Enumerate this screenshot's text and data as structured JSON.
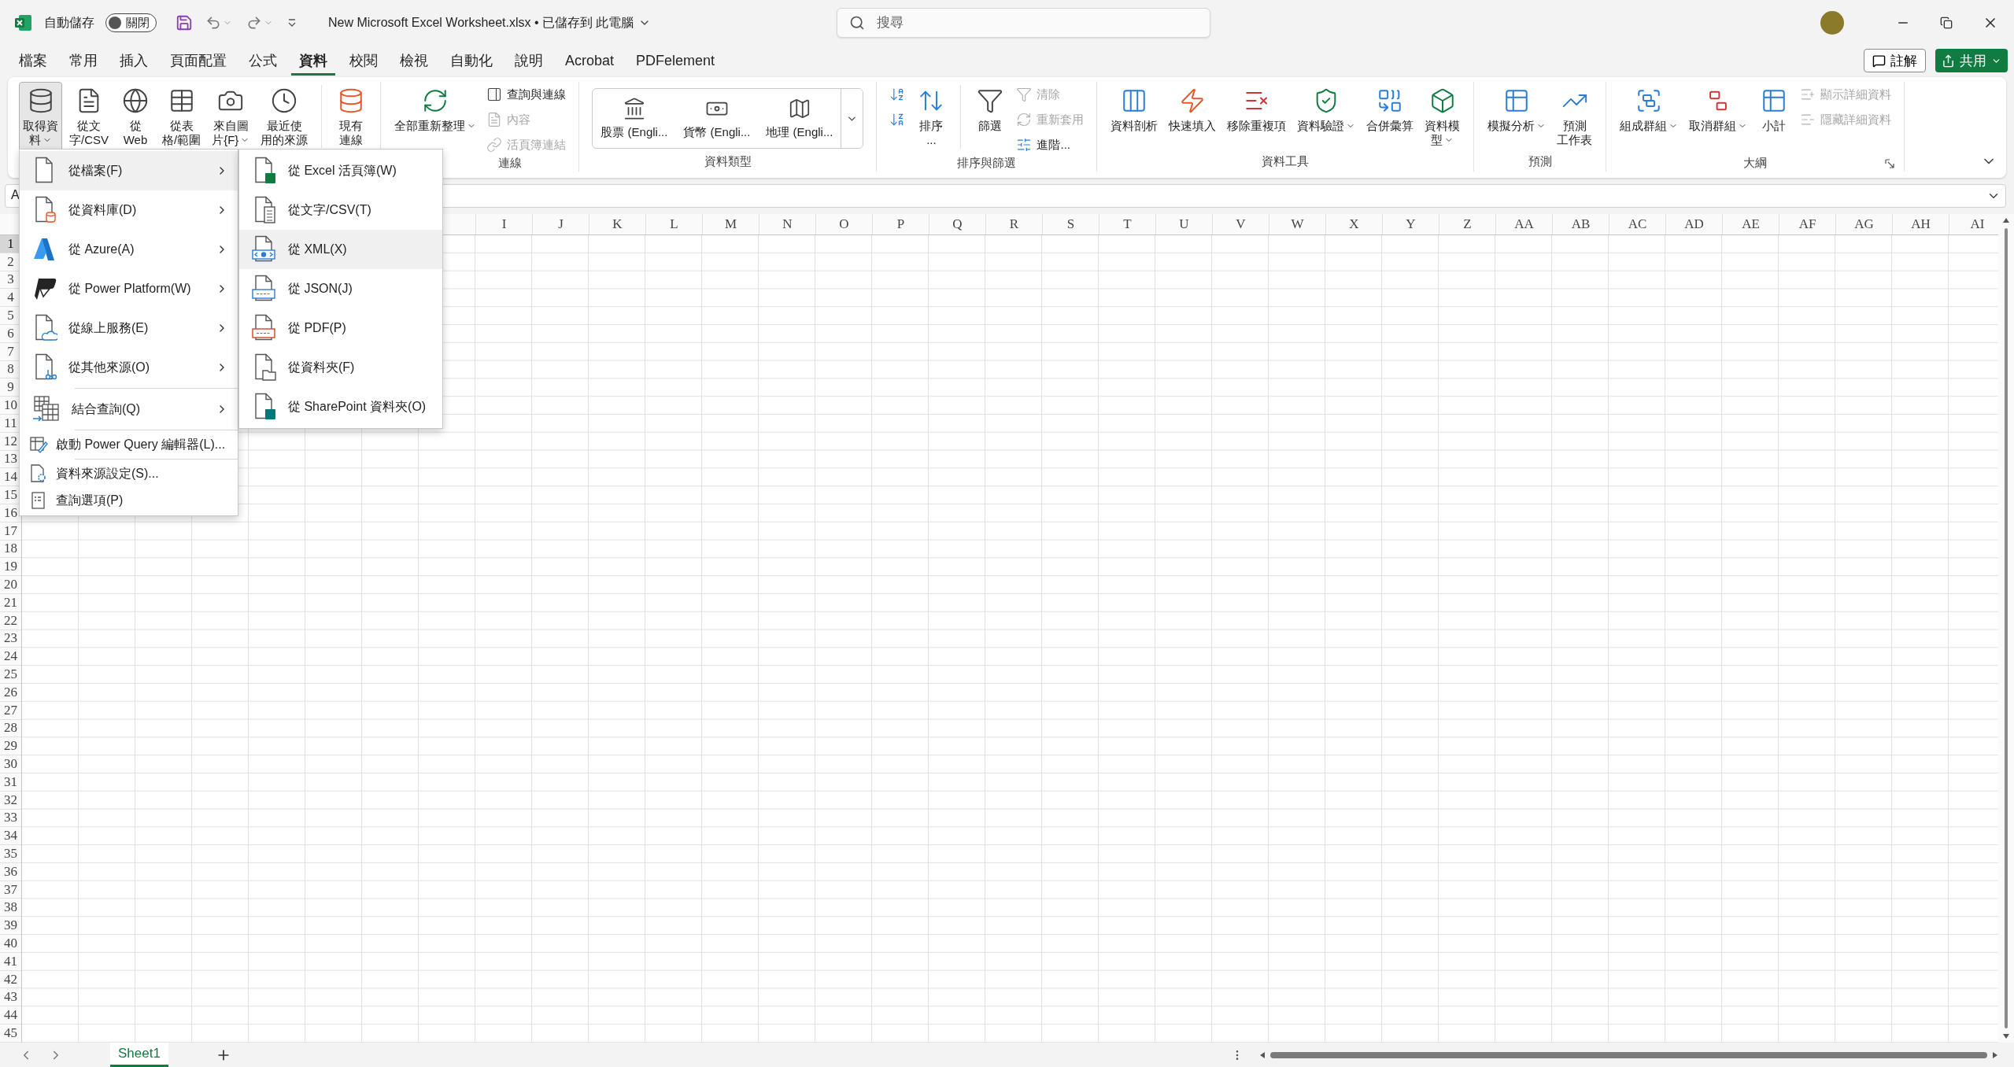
{
  "title_bar": {
    "autosave_label": "自動儲存",
    "autosave": {
      "on": false,
      "label": "關閉"
    },
    "document_title": "New Microsoft Excel Worksheet.xlsx • 已儲存到 此電腦",
    "search": {
      "placeholder": "搜尋"
    }
  },
  "tabs": [
    {
      "label": "檔案",
      "selected": false
    },
    {
      "label": "常用",
      "selected": false
    },
    {
      "label": "插入",
      "selected": false
    },
    {
      "label": "頁面配置",
      "selected": false
    },
    {
      "label": "公式",
      "selected": false
    },
    {
      "label": "資料",
      "selected": true
    },
    {
      "label": "校閱",
      "selected": false
    },
    {
      "label": "檢視",
      "selected": false
    },
    {
      "label": "自動化",
      "selected": false
    },
    {
      "label": "說明",
      "selected": false
    },
    {
      "label": "Acrobat",
      "selected": false
    },
    {
      "label": "PDFelement",
      "selected": false
    }
  ],
  "comments_button": "註解",
  "share_button": "共用",
  "ribbon": {
    "groups": [
      {
        "items": [
          {
            "kind": "large",
            "lines": [
              "取得資",
              "料"
            ],
            "dropdown": true,
            "pressed": true
          },
          {
            "kind": "large",
            "lines": [
              "從文",
              "字/CSV"
            ],
            "dropdown": false,
            "pressed": false
          },
          {
            "kind": "large",
            "lines": [
              "從",
              "Web"
            ],
            "dropdown": false,
            "pressed": false
          },
          {
            "kind": "large",
            "lines": [
              "從表",
              "格/範圍"
            ],
            "dropdown": false,
            "pressed": false
          },
          {
            "kind": "large",
            "lines": [
              "來自圖",
              "片{F}"
            ],
            "dropdown": true,
            "pressed": false
          },
          {
            "kind": "large",
            "lines": [
              "最近使",
              "用的來源"
            ],
            "dropdown": false,
            "pressed": false
          },
          {
            "kind": "separator"
          },
          {
            "kind": "large",
            "lines": [
              "現有",
              "連線"
            ],
            "dropdown": false,
            "pressed": false
          }
        ]
      },
      {
        "label": "連線",
        "items": [
          {
            "kind": "large",
            "lines": [
              "全部重新整理"
            ],
            "dropdown": true,
            "pressed": false
          },
          {
            "kind": "stack",
            "items": [
              {
                "label": "查詢與連線",
                "disabled": false
              },
              {
                "label": "內容",
                "disabled": true
              },
              {
                "label": "活頁簿連結",
                "disabled": true
              }
            ]
          }
        ]
      },
      {
        "label": "資料類型",
        "items": [
          {
            "kind": "gallery",
            "items": [
              {
                "label": "股票 (Engli..."
              },
              {
                "label": "貨幣 (Engli..."
              },
              {
                "label": "地理 (Engli..."
              }
            ]
          }
        ]
      },
      {
        "label": "排序與篩選",
        "items": [
          {
            "kind": "stack",
            "items": [
              {
                "disabled": false
              },
              {
                "disabled": false
              }
            ]
          },
          {
            "kind": "large",
            "lines": [
              "排序",
              "..."
            ],
            "dropdown": false,
            "pressed": false
          },
          {
            "kind": "separator"
          },
          {
            "kind": "large",
            "lines": [
              "篩選"
            ],
            "dropdown": false,
            "pressed": false
          },
          {
            "kind": "stack",
            "items": [
              {
                "label": "清除",
                "disabled": true
              },
              {
                "label": "重新套用",
                "disabled": true
              },
              {
                "label": "進階...",
                "disabled": false
              }
            ]
          }
        ]
      },
      {
        "label": "資料工具",
        "items": [
          {
            "kind": "large",
            "lines": [
              "資料剖析"
            ],
            "dropdown": false,
            "pressed": false
          },
          {
            "kind": "large",
            "lines": [
              "快速填入"
            ],
            "dropdown": false,
            "pressed": false
          },
          {
            "kind": "large",
            "lines": [
              "移除重複項"
            ],
            "dropdown": false,
            "pressed": false
          },
          {
            "kind": "large",
            "lines": [
              "資料驗證"
            ],
            "dropdown": true,
            "pressed": false
          },
          {
            "kind": "large",
            "lines": [
              "合併彙算"
            ],
            "dropdown": false,
            "pressed": false
          },
          {
            "kind": "large",
            "lines": [
              "資料模",
              "型"
            ],
            "dropdown": true,
            "pressed": false
          }
        ]
      },
      {
        "label": "預測",
        "items": [
          {
            "kind": "large",
            "lines": [
              "模擬分析"
            ],
            "dropdown": true,
            "pressed": false
          },
          {
            "kind": "large",
            "lines": [
              "預測",
              "工作表"
            ],
            "dropdown": false,
            "pressed": false
          }
        ]
      },
      {
        "label": "大綱",
        "items": [
          {
            "kind": "large",
            "lines": [
              "組成群組"
            ],
            "dropdown": true,
            "pressed": false
          },
          {
            "kind": "large",
            "lines": [
              "取消群組"
            ],
            "dropdown": true,
            "pressed": false
          },
          {
            "kind": "large",
            "lines": [
              "小計"
            ],
            "dropdown": false,
            "pressed": false
          },
          {
            "kind": "stack",
            "items": [
              {
                "label": "顯示詳細資料",
                "disabled": true
              },
              {
                "label": "隱藏詳細資料",
                "disabled": true
              }
            ]
          }
        ]
      }
    ]
  },
  "formula_bar": {
    "name_box": "A"
  },
  "columns": [
    "I",
    "J",
    "K",
    "L",
    "M",
    "N",
    "O",
    "P",
    "Q",
    "R",
    "S",
    "T",
    "U",
    "V",
    "W",
    "X",
    "Y",
    "Z",
    "AA",
    "AB",
    "AC",
    "AD",
    "AE",
    "AF",
    "AG",
    "AH",
    "AI"
  ],
  "rows": [
    {
      "label": "1",
      "selected": true
    },
    {
      "label": "2",
      "selected": false
    },
    {
      "label": "3",
      "selected": false
    },
    {
      "label": "4",
      "selected": false
    },
    {
      "label": "5",
      "selected": false
    },
    {
      "label": "6",
      "selected": false
    },
    {
      "label": "7",
      "selected": false
    },
    {
      "label": "8",
      "selected": false
    },
    {
      "label": "9",
      "selected": false
    },
    {
      "label": "10",
      "selected": false
    },
    {
      "label": "11",
      "selected": false
    },
    {
      "label": "12",
      "selected": false
    },
    {
      "label": "13",
      "selected": false
    },
    {
      "label": "14",
      "selected": false
    },
    {
      "label": "15",
      "selected": false
    },
    {
      "label": "16",
      "selected": false
    },
    {
      "label": "17",
      "selected": false
    },
    {
      "label": "18",
      "selected": false
    },
    {
      "label": "19",
      "selected": false
    },
    {
      "label": "20",
      "selected": false
    },
    {
      "label": "21",
      "selected": false
    },
    {
      "label": "22",
      "selected": false
    },
    {
      "label": "23",
      "selected": false
    },
    {
      "label": "24",
      "selected": false
    },
    {
      "label": "25",
      "selected": false
    },
    {
      "label": "26",
      "selected": false
    },
    {
      "label": "27",
      "selected": false
    },
    {
      "label": "28",
      "selected": false
    },
    {
      "label": "29",
      "selected": false
    },
    {
      "label": "30",
      "selected": false
    },
    {
      "label": "31",
      "selected": false
    },
    {
      "label": "32",
      "selected": false
    },
    {
      "label": "33",
      "selected": false
    },
    {
      "label": "34",
      "selected": false
    },
    {
      "label": "35",
      "selected": false
    },
    {
      "label": "36",
      "selected": false
    },
    {
      "label": "37",
      "selected": false
    },
    {
      "label": "38",
      "selected": false
    },
    {
      "label": "39",
      "selected": false
    },
    {
      "label": "40",
      "selected": false
    },
    {
      "label": "41",
      "selected": false
    },
    {
      "label": "42",
      "selected": false
    },
    {
      "label": "43",
      "selected": false
    },
    {
      "label": "44",
      "selected": false
    },
    {
      "label": "45",
      "selected": false
    }
  ],
  "sheets": [
    {
      "label": "Sheet1",
      "selected": true
    }
  ],
  "get_data_menu": {
    "items": [
      {
        "kind": "large",
        "label": "從檔案(F)",
        "submenu": true,
        "selected": true
      },
      {
        "kind": "large",
        "label": "從資料庫(D)",
        "submenu": true,
        "selected": false
      },
      {
        "kind": "large",
        "label": "從 Azure(A)",
        "submenu": true,
        "selected": false
      },
      {
        "kind": "large",
        "label": "從 Power Platform(W)",
        "submenu": true,
        "selected": false
      },
      {
        "kind": "large",
        "label": "從線上服務(E)",
        "submenu": true,
        "selected": false
      },
      {
        "kind": "large",
        "label": "從其他來源(O)",
        "submenu": true,
        "selected": false
      },
      {
        "kind": "separator"
      },
      {
        "kind": "large",
        "label": "結合查詢(Q)",
        "submenu": true,
        "selected": false
      },
      {
        "kind": "separator"
      },
      {
        "kind": "small",
        "label": "啟動 Power Query 編輯器(L)...",
        "submenu": false,
        "selected": false
      },
      {
        "kind": "separator"
      },
      {
        "kind": "small",
        "label": "資料來源設定(S)...",
        "submenu": false,
        "selected": false
      },
      {
        "kind": "small",
        "label": "查詢選項(P)",
        "submenu": false,
        "selected": false
      }
    ]
  },
  "from_file_menu": {
    "items": [
      {
        "label": "從 Excel 活頁簿(W)",
        "selected": false
      },
      {
        "label": "從文字/CSV(T)",
        "selected": false
      },
      {
        "label": "從 XML(X)",
        "selected": true
      },
      {
        "label": "從 JSON(J)",
        "selected": false
      },
      {
        "label": "從 PDF(P)",
        "selected": false
      },
      {
        "label": "從資料夾(F)",
        "selected": false
      },
      {
        "label": "從 SharePoint 資料夾(O)",
        "selected": false
      }
    ]
  }
}
